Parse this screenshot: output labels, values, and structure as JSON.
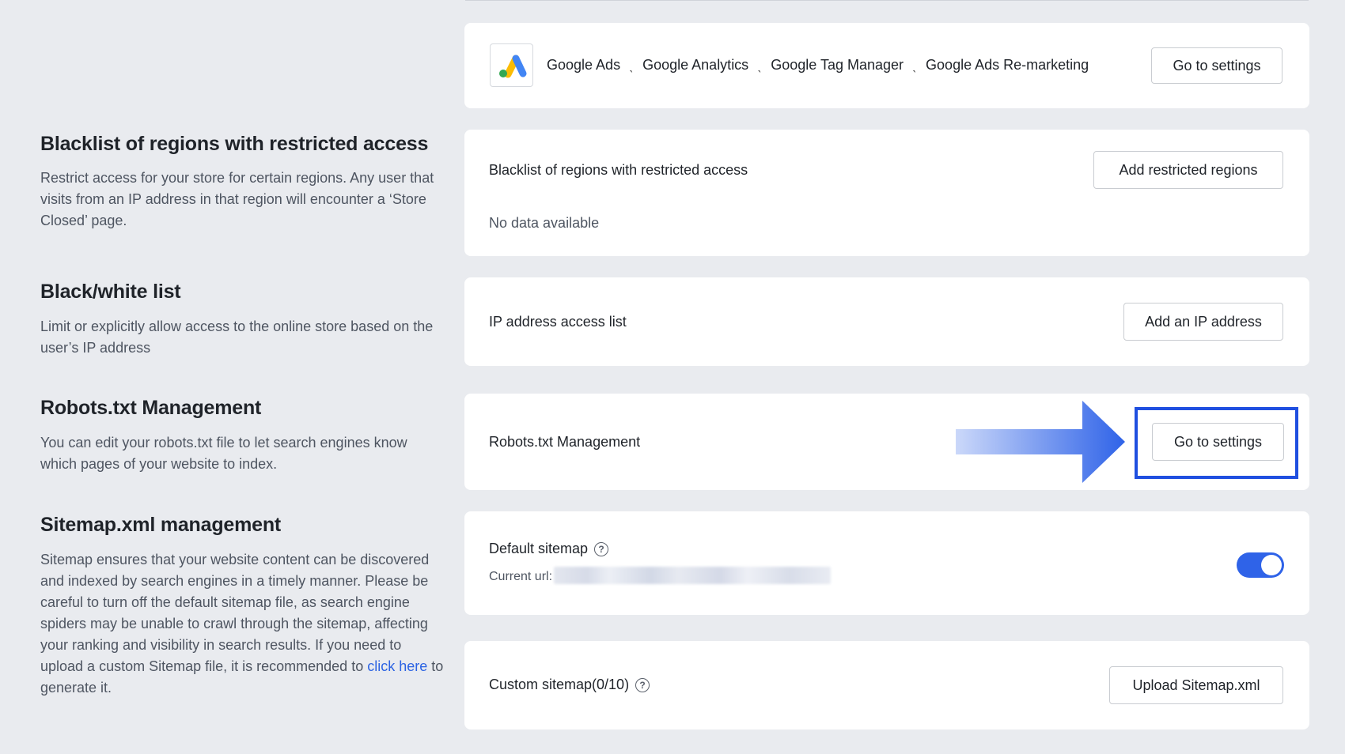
{
  "integrations": {
    "chain": [
      "Google Ads",
      "Google Analytics",
      "Google Tag Manager",
      "Google Ads Re-marketing"
    ],
    "separator": "ˎ",
    "button": "Go to settings"
  },
  "blacklist": {
    "title": "Blacklist of regions with restricted access",
    "description": "Restrict access for your store for certain regions. Any user that visits from an IP address in that region will encounter a ‘Store Closed’ page.",
    "card_label": "Blacklist of regions with restricted access",
    "empty_text": "No data available",
    "button": "Add restricted regions"
  },
  "bw_list": {
    "title": "Black/white list",
    "description": "Limit or explicitly allow access to the online store based on the user’s IP address",
    "card_label": "IP address access list",
    "button": "Add an IP address"
  },
  "robots": {
    "title": "Robots.txt Management",
    "description": "You can edit your robots.txt file to let search engines know which pages of your website to index.",
    "card_label": "Robots.txt Management",
    "button": "Go to settings"
  },
  "sitemap": {
    "title": "Sitemap.xml management",
    "description_before": "Sitemap ensures that your website content can be discovered and indexed by search engines in a timely manner. Please be careful to turn off the default sitemap file, as search engine spiders may be unable to crawl through the sitemap, affecting your ranking and visibility in search results. If you need to upload a custom Sitemap file, it is recommended to ",
    "link": "click here",
    "description_after": " to generate it.",
    "default_label": "Default sitemap",
    "current_url_label": "Current url:",
    "default_enabled": true,
    "custom_label": "Custom sitemap(0/10)",
    "upload_button": "Upload Sitemap.xml"
  },
  "colors": {
    "accent": "#2f63e8",
    "link": "#2b63e3",
    "annotation": "#1f4fe0",
    "background": "#e9ebef"
  },
  "icons": {
    "help": "question-circle-icon",
    "logo": "google-ads-logo",
    "annotation_arrow": "arrow-right-icon"
  }
}
